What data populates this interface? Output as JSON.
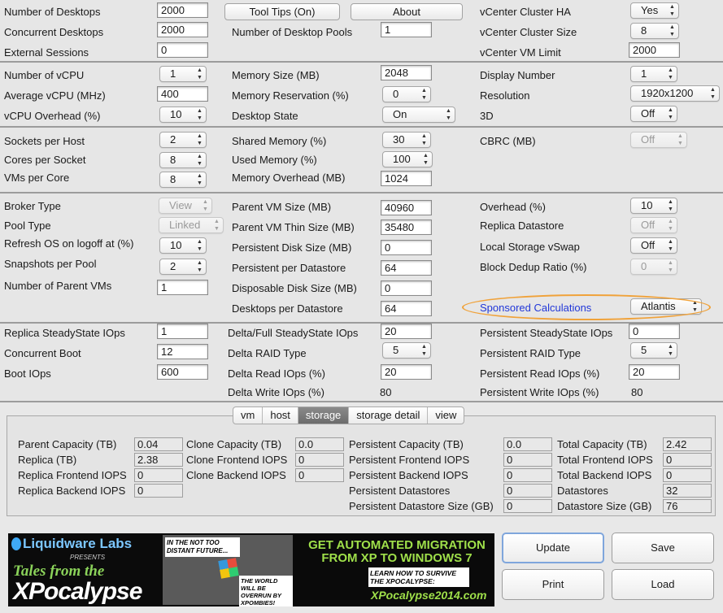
{
  "top": {
    "num_desktops_label": "Number of Desktops",
    "num_desktops": "2000",
    "concurrent_desktops_label": "Concurrent Desktops",
    "concurrent_desktops": "2000",
    "external_sessions_label": "External Sessions",
    "external_sessions": "0",
    "tooltips_button": "Tool Tips (On)",
    "about_button": "About",
    "num_pools_label": "Number of Desktop Pools",
    "num_pools": "1",
    "cluster_ha_label": "vCenter Cluster HA",
    "cluster_ha": "Yes",
    "cluster_size_label": "vCenter Cluster Size",
    "cluster_size": "8",
    "vm_limit_label": "vCenter VM Limit",
    "vm_limit": "2000"
  },
  "vm": {
    "num_vcpu_label": "Number of vCPU",
    "num_vcpu": "1",
    "avg_vcpu_label": "Average vCPU (MHz)",
    "avg_vcpu": "400",
    "vcpu_overhead_label": "vCPU Overhead (%)",
    "vcpu_overhead": "10",
    "memory_size_label": "Memory Size (MB)",
    "memory_size": "2048",
    "memory_reservation_label": "Memory Reservation (%)",
    "memory_reservation": "0",
    "desktop_state_label": "Desktop State",
    "desktop_state": "On",
    "display_number_label": "Display Number",
    "display_number": "1",
    "resolution_label": "Resolution",
    "resolution": "1920x1200",
    "threed_label": "3D",
    "threed": "Off"
  },
  "host": {
    "sockets_label": "Sockets per Host",
    "sockets": "2",
    "cores_label": "Cores per Socket",
    "cores": "8",
    "vms_core_label": "VMs per Core",
    "vms_core": "8",
    "shared_memory_label": "Shared Memory (%)",
    "shared_memory": "30",
    "used_memory_label": "Used Memory (%)",
    "used_memory": "100",
    "memory_overhead_label": "Memory Overhead (MB)",
    "memory_overhead": "1024",
    "cbrc_label": "CBRC (MB)",
    "cbrc": "Off"
  },
  "storage": {
    "broker_type_label": "Broker Type",
    "broker_type": "View",
    "pool_type_label": "Pool Type",
    "pool_type": "Linked",
    "refresh_label": "Refresh OS on logoff at (%)",
    "refresh": "10",
    "snapshots_label": "Snapshots per Pool",
    "snapshots": "2",
    "parent_vms_label": "Number of Parent VMs",
    "parent_vms": "1",
    "parent_size_label": "Parent VM Size (MB)",
    "parent_size": "40960",
    "parent_thin_label": "Parent VM Thin Size (MB)",
    "parent_thin": "35480",
    "persistent_disk_label": "Persistent Disk Size (MB)",
    "persistent_disk": "0",
    "persistent_per_ds_label": "Persistent per Datastore",
    "persistent_per_ds": "64",
    "disposable_disk_label": "Disposable Disk Size (MB)",
    "disposable_disk": "0",
    "desktops_per_ds_label": "Desktops per Datastore",
    "desktops_per_ds": "64",
    "overhead_label": "Overhead (%)",
    "overhead": "10",
    "replica_ds_label": "Replica Datastore",
    "replica_ds": "Off",
    "local_vswap_label": "Local Storage vSwap",
    "local_vswap": "Off",
    "dedup_label": "Block Dedup Ratio (%)",
    "dedup": "0",
    "sponsored_label": "Sponsored Calculations",
    "sponsored": "Atlantis"
  },
  "iops": {
    "replica_ss_label": "Replica SteadyState IOps",
    "replica_ss": "1",
    "concurrent_boot_label": "Concurrent Boot",
    "concurrent_boot": "12",
    "boot_iops_label": "Boot IOps",
    "boot_iops": "600",
    "delta_ss_label": "Delta/Full SteadyState IOps",
    "delta_ss": "20",
    "delta_raid_label": "Delta RAID Type",
    "delta_raid": "5",
    "delta_read_label": "Delta Read IOps (%)",
    "delta_read": "20",
    "delta_write_label": "Delta Write IOps (%)",
    "delta_write": "80",
    "persistent_ss_label": "Persistent SteadyState IOps",
    "persistent_ss": "0",
    "persistent_raid_label": "Persistent RAID Type",
    "persistent_raid": "5",
    "persistent_read_label": "Persistent Read IOps (%)",
    "persistent_read": "20",
    "persistent_write_label": "Persistent Write IOps (%)",
    "persistent_write": "80"
  },
  "tabs": [
    "vm",
    "host",
    "storage",
    "storage detail",
    "view"
  ],
  "active_tab": "storage",
  "results": {
    "parent_capacity_label": "Parent Capacity (TB)",
    "parent_capacity": "0.04",
    "replica_label": "Replica (TB)",
    "replica": "2.38",
    "replica_fe_label": "Replica Frontend IOPS",
    "replica_fe": "0",
    "replica_be_label": "Replica Backend IOPS",
    "replica_be": "0",
    "clone_capacity_label": "Clone Capacity (TB)",
    "clone_capacity": "0.0",
    "clone_fe_label": "Clone Frontend IOPS",
    "clone_fe": "0",
    "clone_be_label": "Clone Backend IOPS",
    "clone_be": "0",
    "pers_capacity_label": "Persistent Capacity (TB)",
    "pers_capacity": "0.0",
    "pers_fe_label": "Persistent Frontend IOPS",
    "pers_fe": "0",
    "pers_be_label": "Persistent Backend IOPS",
    "pers_be": "0",
    "pers_ds_label": "Persistent Datastores",
    "pers_ds": "0",
    "pers_ds_size_label": "Persistent Datastore Size (GB)",
    "pers_ds_size": "0",
    "total_capacity_label": "Total Capacity (TB)",
    "total_capacity": "2.42",
    "total_fe_label": "Total Frontend IOPS",
    "total_fe": "0",
    "total_be_label": "Total Backend IOPS",
    "total_be": "0",
    "datastores_label": "Datastores",
    "datastores": "32",
    "ds_size_label": "Datastore Size (GB)",
    "ds_size": "76"
  },
  "banner": {
    "logo": "Liquidware Labs",
    "presents": "PRESENTS",
    "tales": "Tales from the",
    "xp": "XPocalypse",
    "bubble1": "IN THE NOT TOO DISTANT FUTURE...",
    "bubble2": "THE WORLD WILL BE OVERRUN BY XPOMBIES!",
    "headline1": "GET AUTOMATED MIGRATION",
    "headline2": "FROM XP TO WINDOWS 7",
    "learn": "LEARN HOW TO SURVIVE THE XPOCALYPSE:",
    "url": "XPocalypse2014.com"
  },
  "actions": {
    "update": "Update",
    "save": "Save",
    "print": "Print",
    "load": "Load"
  }
}
